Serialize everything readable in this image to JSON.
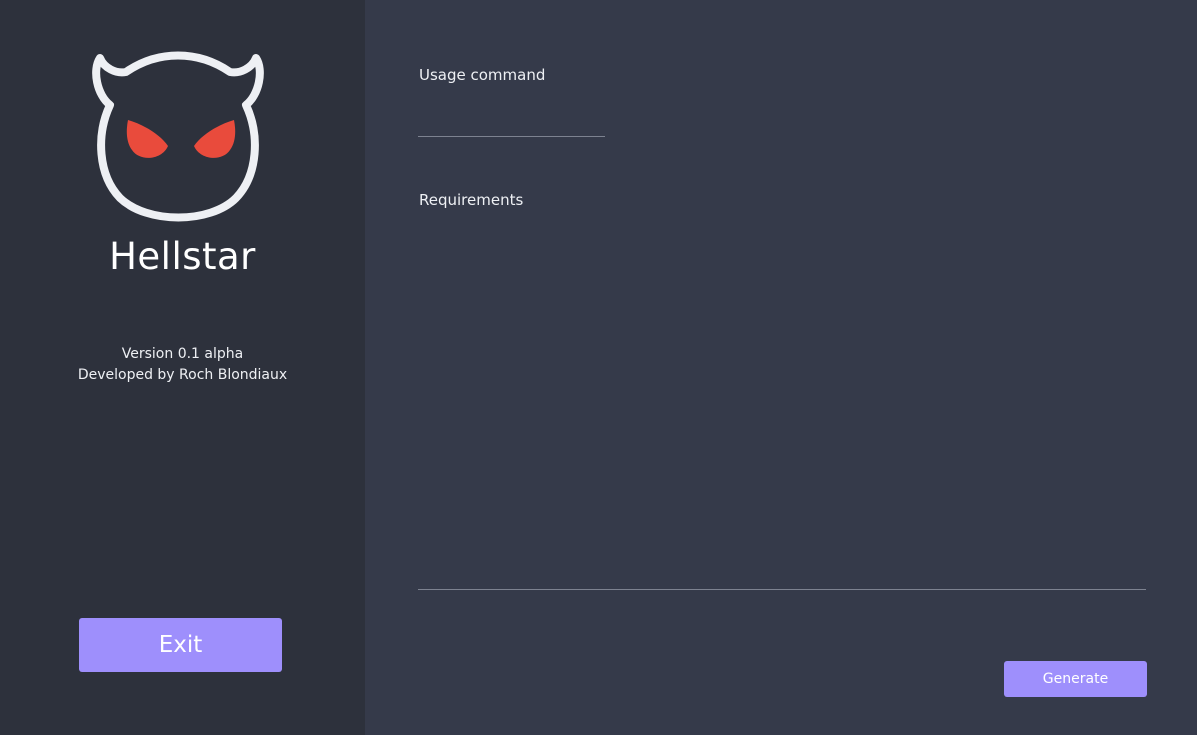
{
  "app": {
    "name": "Hellstar",
    "logo_icon": "devil-face-icon",
    "accent_color": "#9e8ffc",
    "eye_color": "#e94b3c"
  },
  "sidebar": {
    "version": "Version 0.1 alpha",
    "developer": "Developed by Roch Blondiaux",
    "exit_label": "Exit"
  },
  "form": {
    "usage_label": "Usage command",
    "usage_value": "",
    "requirements_label": "Requirements",
    "requirements_value": "",
    "generate_label": "Generate"
  }
}
